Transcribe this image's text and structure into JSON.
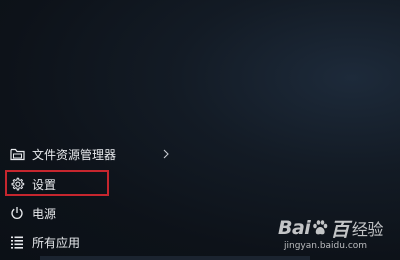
{
  "start_menu": {
    "items": [
      {
        "label": "文件资源管理器",
        "icon": "folder-icon",
        "has_submenu": true
      },
      {
        "label": "设置",
        "icon": "gear-icon",
        "highlighted": true
      },
      {
        "label": "电源",
        "icon": "power-icon"
      },
      {
        "label": "所有应用",
        "icon": "list-icon"
      }
    ]
  },
  "watermark": {
    "brand_left": "Bai",
    "brand_right": "百",
    "brand_suffix": "经验",
    "url": "jingyan.baidu.com"
  },
  "colors": {
    "background": "#0d1219",
    "text": "#e8eaed",
    "highlight_border": "#c6262e"
  }
}
